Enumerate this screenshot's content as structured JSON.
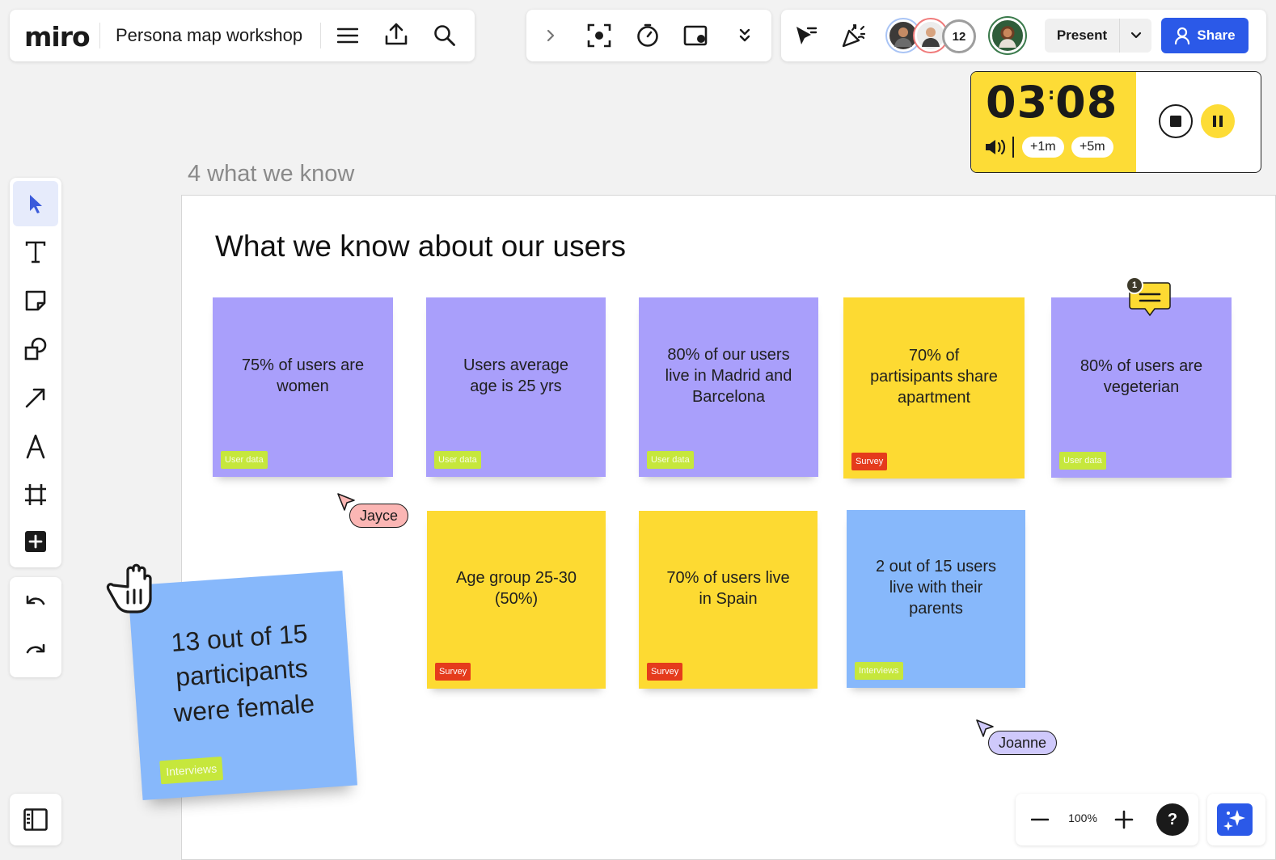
{
  "app": {
    "logo": "miro",
    "board_title": "Persona map workshop"
  },
  "topbar": {
    "avatar_count": "12",
    "present_label": "Present",
    "share_label": "Share"
  },
  "timer": {
    "minutes": "03",
    "separator": ":",
    "seconds": "08",
    "add_one": "+1m",
    "add_five": "+5m"
  },
  "frame": {
    "label": "4 what we know",
    "title": "What we know about our users"
  },
  "stickies": [
    {
      "text": "75% of users are women",
      "tag": "User data"
    },
    {
      "text": "Users average age is 25 yrs",
      "tag": "User data"
    },
    {
      "text": "80% of our users live in Madrid and Barcelona",
      "tag": "User data"
    },
    {
      "text": "70% of partisipants share apartment",
      "tag": "Survey"
    },
    {
      "text": "80% of users are vegeterian",
      "tag": "User data"
    },
    {
      "text": "Age group 25-30 (50%)",
      "tag": "Survey"
    },
    {
      "text": "70% of users live in Spain",
      "tag": "Survey"
    },
    {
      "text": "2 out of 15 users live with their parents",
      "tag": "Interviews"
    },
    {
      "text": "13 out of 15 participants were female",
      "tag": "Interviews"
    }
  ],
  "comment_badge": "1",
  "cursors": [
    {
      "name": "Jayce"
    },
    {
      "name": "Joanne"
    }
  ],
  "zoom": {
    "level": "100%"
  },
  "help_label": "?",
  "colors": {
    "accent": "#2b59e8",
    "sticky_purple": "#a99ffb",
    "sticky_yellow": "#fdda32",
    "sticky_blue": "#87b8fb",
    "tag_green": "#c6e73c",
    "tag_red": "#e53b1c",
    "cursor_jayce": "#fbb6b4",
    "cursor_joanne": "#cfc9fb"
  }
}
